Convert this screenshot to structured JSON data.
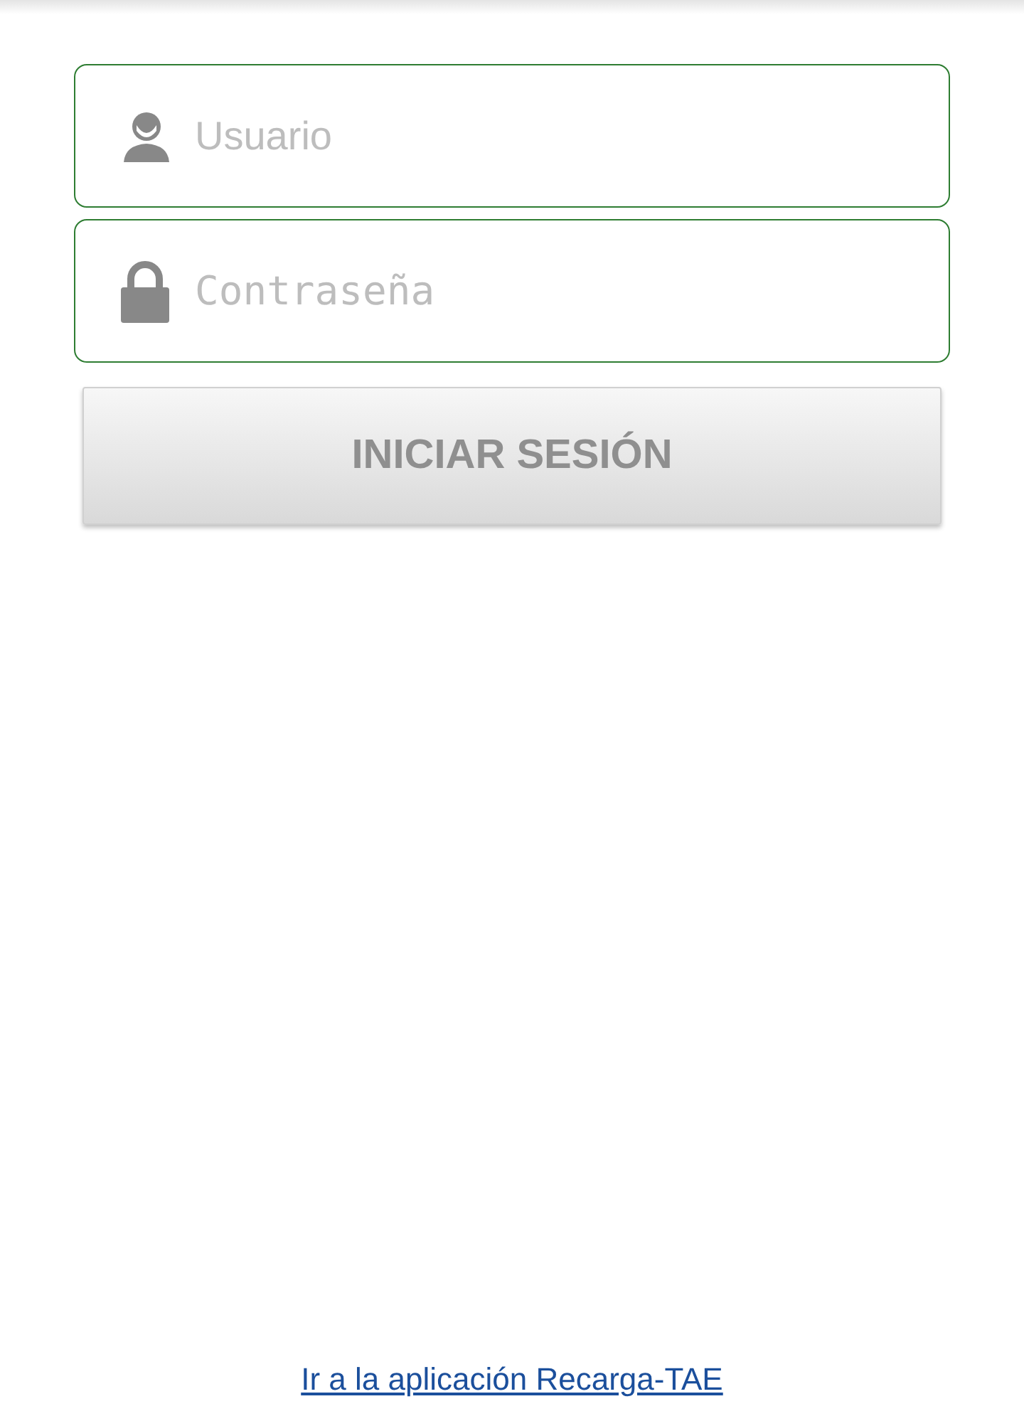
{
  "username_field": {
    "placeholder": "Usuario"
  },
  "password_field": {
    "placeholder": "Contraseña"
  },
  "login_button": {
    "label": "INICIAR SESIÓN"
  },
  "footer_link": {
    "label": "Ir a la aplicación Recarga-TAE"
  }
}
